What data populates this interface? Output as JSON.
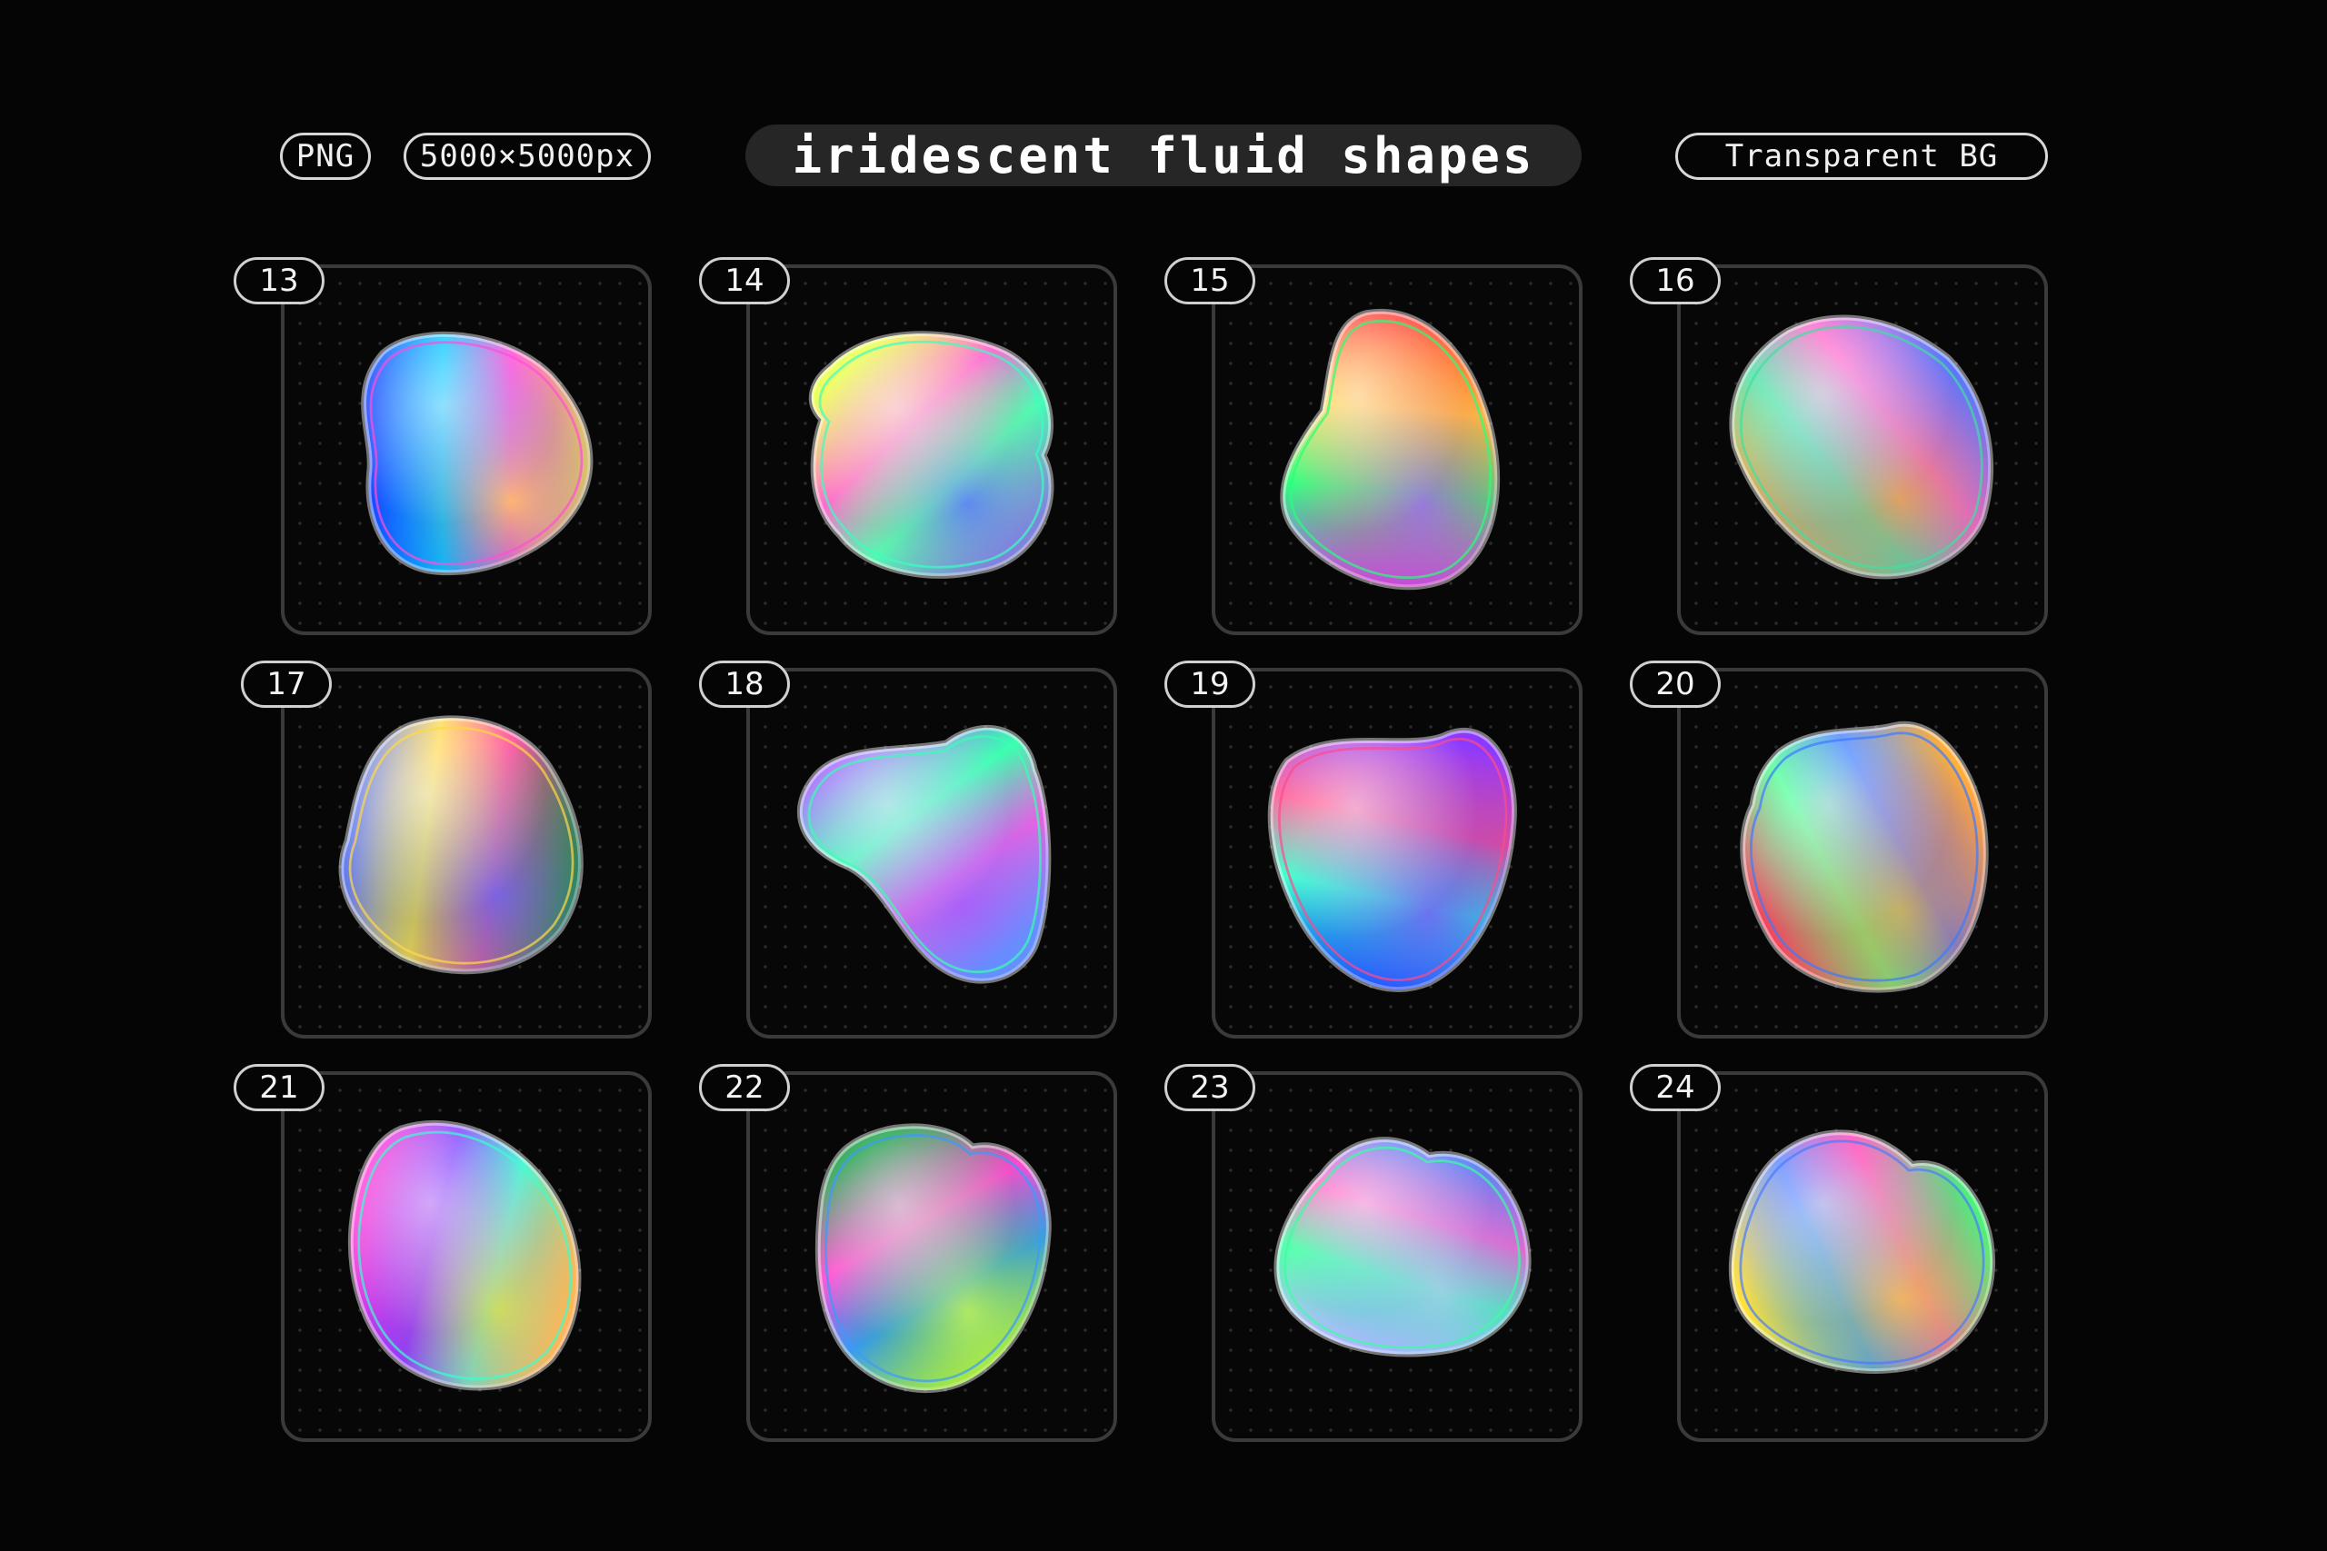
{
  "header": {
    "format_label": "PNG",
    "size_label": "5000×5000px",
    "title": "iridescent fluid shapes",
    "bg_label": "Transparent BG"
  },
  "items": [
    {
      "number": "13",
      "colors": [
        "#1a3cff",
        "#00c8ff",
        "#ff4fd8",
        "#ffe14a"
      ]
    },
    {
      "number": "14",
      "colors": [
        "#e8ff3a",
        "#ff6ad0",
        "#3affc0",
        "#6a6aff"
      ]
    },
    {
      "number": "15",
      "colors": [
        "#ff3a3a",
        "#ffd23a",
        "#2aff7a",
        "#c04aff"
      ]
    },
    {
      "number": "16",
      "colors": [
        "#4a7aff",
        "#ff5ac8",
        "#40e0a0",
        "#ffa040"
      ]
    },
    {
      "number": "17",
      "colors": [
        "#2a8a4a",
        "#ff4fa0",
        "#ffd84a",
        "#4a6aff"
      ]
    },
    {
      "number": "18",
      "colors": [
        "#5a9aff",
        "#ff5adc",
        "#3affb0",
        "#9a5aff"
      ]
    },
    {
      "number": "19",
      "colors": [
        "#1a5aff",
        "#2affc8",
        "#ff4a8a",
        "#8a3aff"
      ]
    },
    {
      "number": "20",
      "colors": [
        "#ff3a5a",
        "#3aff8a",
        "#3a7aff",
        "#ffb03a"
      ]
    },
    {
      "number": "21",
      "colors": [
        "#ff3ad8",
        "#7a3aff",
        "#3affd0",
        "#ffd03a"
      ]
    },
    {
      "number": "22",
      "colors": [
        "#0a9a3a",
        "#ff4ad0",
        "#3a9aff",
        "#d0ff3a"
      ]
    },
    {
      "number": "23",
      "colors": [
        "#4a8aff",
        "#ff5ac0",
        "#3affa0",
        "#c0c0ff"
      ]
    },
    {
      "number": "24",
      "colors": [
        "#3aff7a",
        "#ff3ab0",
        "#4a7aff",
        "#ffe03a"
      ]
    }
  ]
}
